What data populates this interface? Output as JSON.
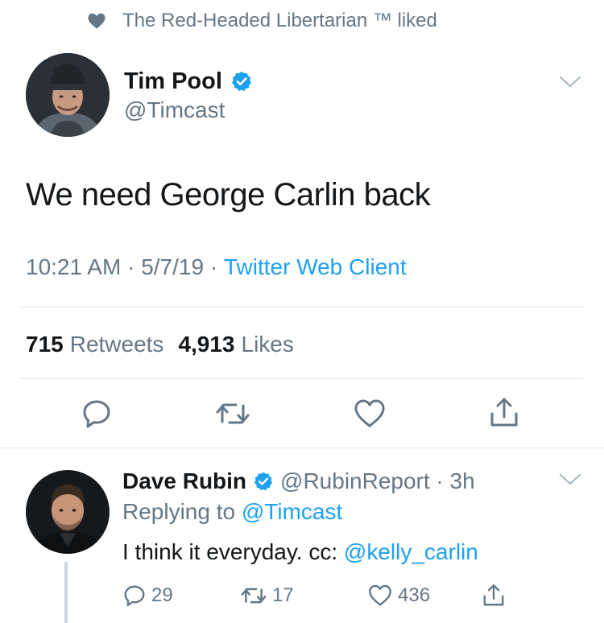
{
  "social_context": {
    "icon": "heart-icon",
    "text": "The Red-Headed Libertarian ™ liked"
  },
  "tweet": {
    "author_name": "Tim Pool",
    "author_handle": "@Timcast",
    "verified_icon": "verified-badge-icon",
    "text": "We need George Carlin back",
    "time": "10:21 AM",
    "date": "5/7/19",
    "separator": " · ",
    "source": "Twitter Web Client",
    "retweets_count": "715",
    "retweets_label": "Retweets",
    "likes_count": "4,913",
    "likes_label": "Likes"
  },
  "actions": {
    "reply_icon": "reply-icon",
    "retweet_icon": "retweet-icon",
    "like_icon": "like-icon",
    "share_icon": "share-icon"
  },
  "reply": {
    "author_name": "Dave Rubin",
    "author_handle": "@RubinReport",
    "time_sep": " · ",
    "time": "3h",
    "replying_label": "Replying to ",
    "replying_to": "@Timcast",
    "text": "I think it everyday. cc: ",
    "mention": "@kelly_carlin",
    "reply_count": "29",
    "retweet_count": "17",
    "like_count": "436"
  },
  "colors": {
    "accent": "#1da1f2",
    "secondary_text": "#657786",
    "primary_text": "#14171a",
    "divider": "#e1e8ed"
  }
}
